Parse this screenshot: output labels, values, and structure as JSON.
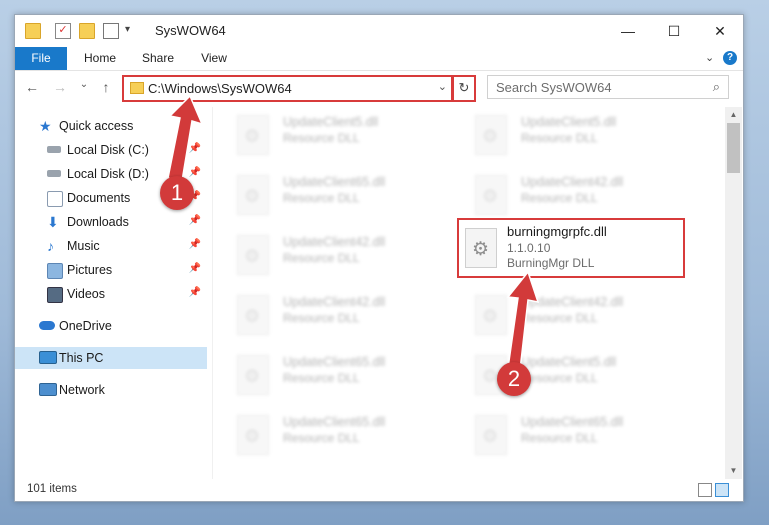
{
  "window": {
    "title": "SysWOW64"
  },
  "ribbon": {
    "tabs": [
      "File",
      "Home",
      "Share",
      "View"
    ],
    "expand": "⌄",
    "help": "?"
  },
  "nav": {
    "address": "C:\\Windows\\SysWOW64",
    "search_placeholder": "Search SysWOW64"
  },
  "sidebar": {
    "items": [
      {
        "label": "Quick access",
        "icon": "star-icon"
      },
      {
        "label": "Local Disk (C:)",
        "icon": "drive-icon"
      },
      {
        "label": "Local Disk (D:)",
        "icon": "drive-icon"
      },
      {
        "label": "Documents",
        "icon": "documents-icon"
      },
      {
        "label": "Downloads",
        "icon": "downloads-icon"
      },
      {
        "label": "Music",
        "icon": "music-icon"
      },
      {
        "label": "Pictures",
        "icon": "pictures-icon"
      },
      {
        "label": "Videos",
        "icon": "videos-icon"
      },
      {
        "label": "OneDrive",
        "icon": "cloud-icon"
      },
      {
        "label": "This PC",
        "icon": "pc-icon"
      },
      {
        "label": "Network",
        "icon": "network-icon"
      }
    ]
  },
  "files": {
    "left": [
      {
        "name": "UpdateClient5.dll",
        "desc": "Resource DLL"
      },
      {
        "name": "UpdateClient65.dll",
        "desc": "Resource DLL"
      },
      {
        "name": "UpdateClient42.dll",
        "desc": "Resource DLL"
      },
      {
        "name": "UpdateClient42.dll",
        "desc": "Resource DLL"
      },
      {
        "name": "UpdateClient65.dll",
        "desc": "Resource DLL"
      },
      {
        "name": "UpdateClient65.dll",
        "desc": "Resource DLL"
      }
    ],
    "right": [
      {
        "name": "UpdateClient5.dll",
        "desc": "Resource DLL"
      },
      {
        "name": "UpdateClient42.dll",
        "desc": "Resource DLL"
      },
      {
        "name": "UpdateClient42.dll",
        "desc": "Resource DLL"
      },
      {
        "name": "UpdateClient5.dll",
        "desc": "Resource DLL"
      },
      {
        "name": "UpdateClient65.dll",
        "desc": "Resource DLL"
      }
    ],
    "highlighted": {
      "name": "burningmgrpfc.dll",
      "version": "1.1.0.10",
      "desc": "BurningMgr DLL"
    }
  },
  "status": {
    "items": "101 items"
  },
  "annotations": {
    "step1": "1",
    "step2": "2"
  },
  "colors": {
    "accent": "#1979ca",
    "annotation": "#d23a3a",
    "selection": "#cce4f7"
  }
}
